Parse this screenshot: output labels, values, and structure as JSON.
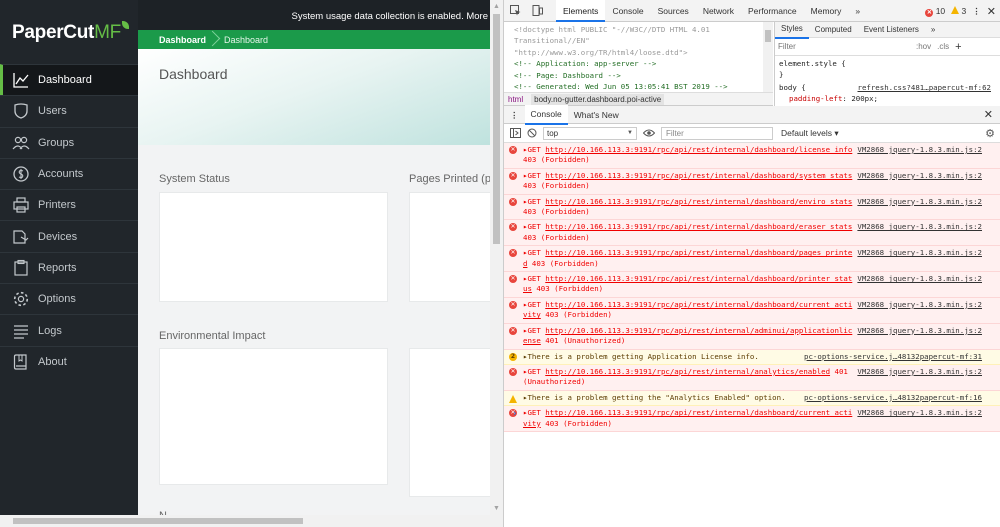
{
  "logo": {
    "paper": "PaperCut",
    "mf": "MF"
  },
  "sidebar": {
    "items": [
      {
        "label": "Dashboard",
        "icon": "chart-line-icon"
      },
      {
        "label": "Users",
        "icon": "user-shield-icon"
      },
      {
        "label": "Groups",
        "icon": "users-group-icon"
      },
      {
        "label": "Accounts",
        "icon": "dollar-circle-icon"
      },
      {
        "label": "Printers",
        "icon": "printer-icon"
      },
      {
        "label": "Devices",
        "icon": "devices-icon"
      },
      {
        "label": "Reports",
        "icon": "clipboard-icon"
      },
      {
        "label": "Options",
        "icon": "gear-icon"
      },
      {
        "label": "Logs",
        "icon": "list-icon"
      },
      {
        "label": "About",
        "icon": "book-icon"
      }
    ]
  },
  "main": {
    "notice": "System usage data collection is enabled. More",
    "breadcrumb": [
      "Dashboard",
      "Dashboard"
    ],
    "page_title": "Dashboard",
    "sections": {
      "status": "System Status",
      "pages": "Pages Printed (pe",
      "env": "Environmental Impact",
      "bottom": "N"
    }
  },
  "devtools": {
    "tabs": [
      "Elements",
      "Console",
      "Sources",
      "Network",
      "Performance",
      "Memory"
    ],
    "errors": "10",
    "warnings": "3",
    "elements_lines": [
      "<!doctype html PUBLIC \"-//W3C//DTD HTML 4.01",
      "Transitional//EN\"",
      "\"http://www.w3.org/TR/html4/loose.dtd\">",
      "<!-- Application: app-server -->",
      "<!-- Page: Dashboard -->",
      "<!-- Generated: Wed Jun 05 13:05:41 BST 2019 -->"
    ],
    "crumbs": [
      "html",
      "body.no-gutter.dashboard.poi-active"
    ],
    "styles_tabs": [
      "Styles",
      "Computed",
      "Event Listeners"
    ],
    "styles_filter": "Filter",
    "styles_hov": ":hov",
    "styles_cls": ".cls",
    "element_style": "element.style {",
    "close_brace": "}",
    "body_rule": "body {",
    "body_link": "refresh.css?481…papercut-mf:62",
    "body_prop": "padding-left",
    "body_val": "200px;",
    "drawer_tabs": [
      "Console",
      "What's New"
    ],
    "context": "top",
    "console_filter": "Filter",
    "levels": "Default levels ▾",
    "messages": [
      {
        "type": "error",
        "method": "GET",
        "url": "http://10.166.113.3:9191/rpc/api/rest/internal/dashboard/license_info",
        "status": "403 (Forbidden)",
        "src": "VM2868 jquery-1.8.3.min.js:2"
      },
      {
        "type": "error",
        "method": "GET",
        "url": "http://10.166.113.3:9191/rpc/api/rest/internal/dashboard/system_stats",
        "status": "403 (Forbidden)",
        "src": "VM2868 jquery-1.8.3.min.js:2"
      },
      {
        "type": "error",
        "method": "GET",
        "url": "http://10.166.113.3:9191/rpc/api/rest/internal/dashboard/enviro_stats",
        "status": "403 (Forbidden)",
        "src": "VM2868 jquery-1.8.3.min.js:2"
      },
      {
        "type": "error",
        "method": "GET",
        "url": "http://10.166.113.3:9191/rpc/api/rest/internal/dashboard/eraser_stats",
        "status": "403 (Forbidden)",
        "src": "VM2868 jquery-1.8.3.min.js:2"
      },
      {
        "type": "error",
        "method": "GET",
        "url": "http://10.166.113.3:9191/rpc/api/rest/internal/dashboard/pages_printed",
        "status": "403 (Forbidden)",
        "src": "VM2868 jquery-1.8.3.min.js:2"
      },
      {
        "type": "error",
        "method": "GET",
        "url": "http://10.166.113.3:9191/rpc/api/rest/internal/dashboard/printer_status",
        "status": "403 (Forbidden)",
        "src": "VM2868 jquery-1.8.3.min.js:2"
      },
      {
        "type": "error",
        "method": "GET",
        "url": "http://10.166.113.3:9191/rpc/api/rest/internal/dashboard/current_activity",
        "status": "403 (Forbidden)",
        "src": "VM2868 jquery-1.8.3.min.js:2"
      },
      {
        "type": "error",
        "method": "GET",
        "url": "http://10.166.113.3:9191/rpc/api/rest/internal/adminui/applicationlicense",
        "status": "401 (Unauthorized)",
        "src": "VM2868 jquery-1.8.3.min.js:2"
      },
      {
        "type": "warn-count",
        "count": "2",
        "text": "There is a problem getting Application License info.",
        "src": "pc-options-service.j…48132papercut-mf:31"
      },
      {
        "type": "error",
        "method": "GET",
        "url": "http://10.166.113.3:9191/rpc/api/rest/internal/analytics/enabled",
        "status": "401 (Unauthorized)",
        "src": "VM2868 jquery-1.8.3.min.js:2"
      },
      {
        "type": "warn",
        "text": "There is a problem getting the \"Analytics Enabled\" option.",
        "src": "pc-options-service.j…48132papercut-mf:16"
      },
      {
        "type": "error",
        "method": "GET",
        "url": "http://10.166.113.3:9191/rpc/api/rest/internal/dashboard/current_activity",
        "status": "403 (Forbidden)",
        "src": "VM2868 jquery-1.8.3.min.js:2"
      }
    ]
  }
}
